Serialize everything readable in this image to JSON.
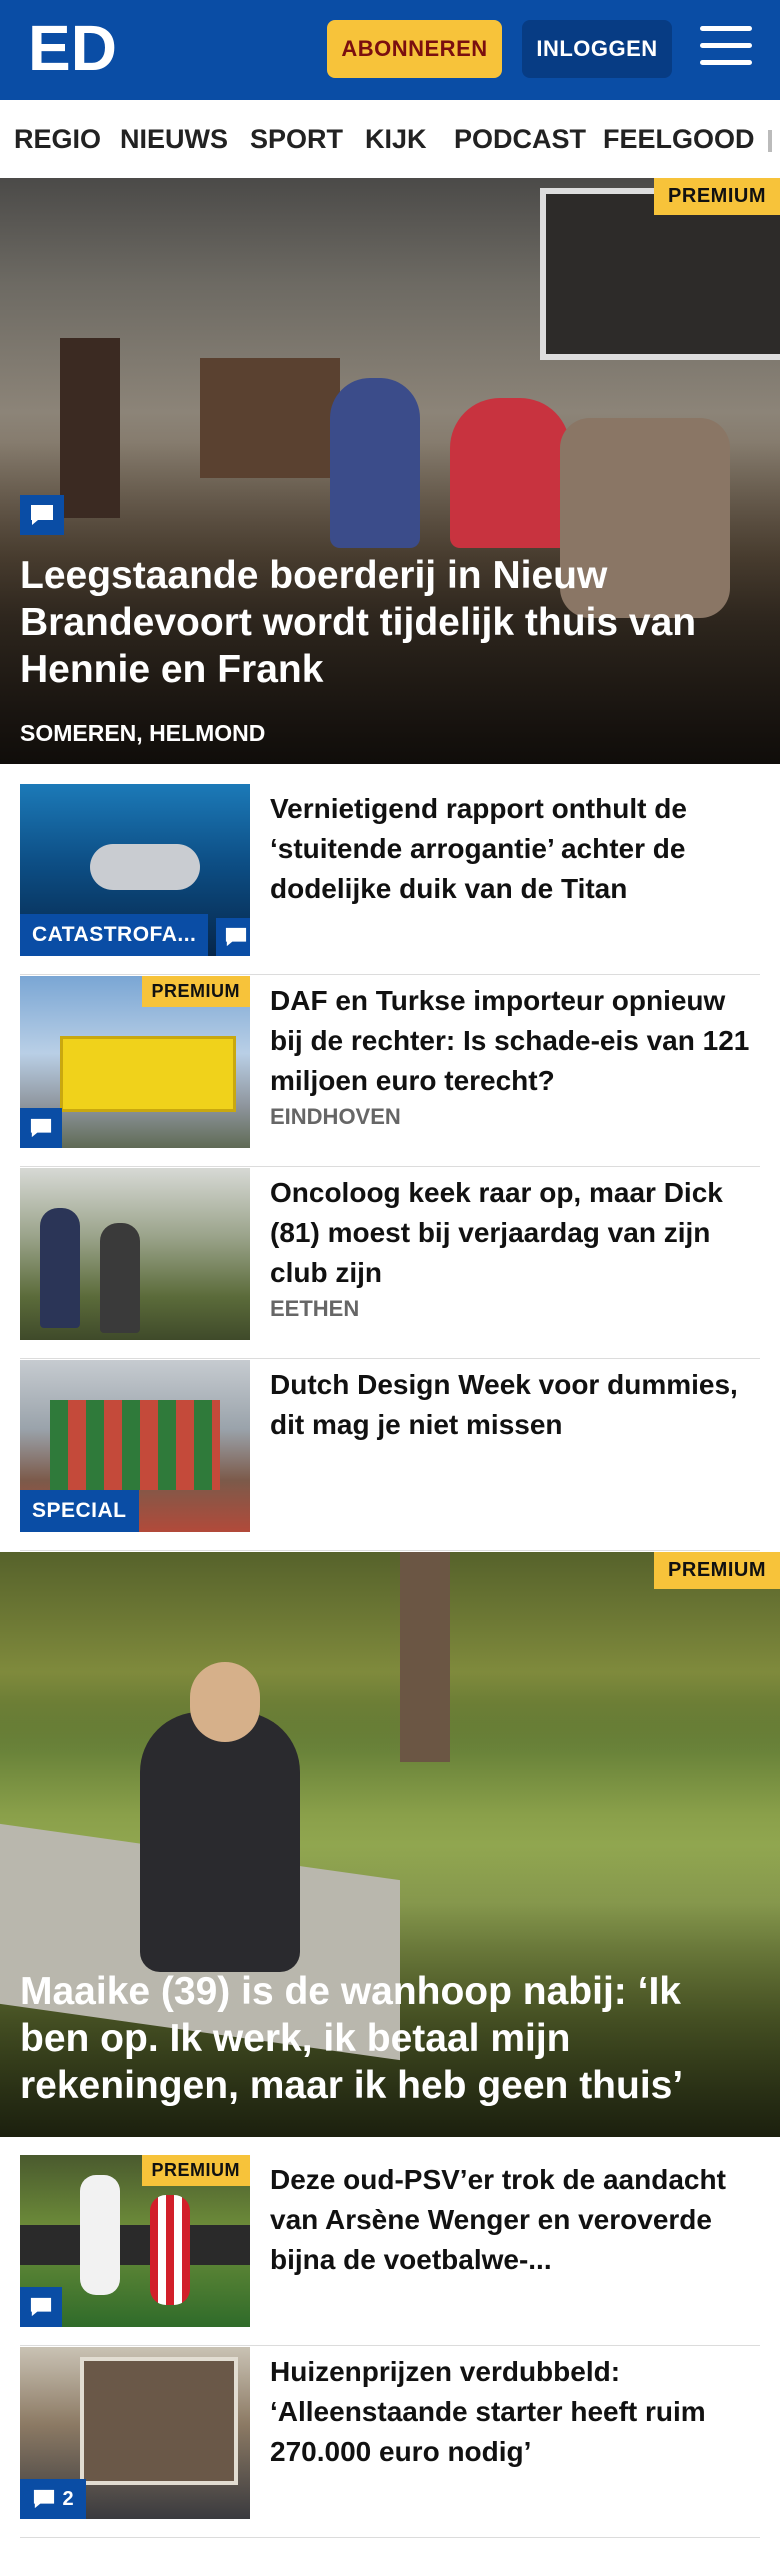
{
  "header": {
    "logo_text": "ED",
    "subscribe_label": "ABONNEREN",
    "login_label": "INLOGGEN"
  },
  "nav": {
    "items": [
      "REGIO",
      "NIEUWS",
      "SPORT",
      "KIJK",
      "PODCAST",
      "FEELGOOD"
    ]
  },
  "hero1": {
    "badge": "PREMIUM",
    "title": "Leegstaande boerderij in Nieuw Brandevoort wordt tijdelijk thuis van Hennie en Frank",
    "location": "SOMEREN, HELMOND",
    "icon": "comment-icon"
  },
  "articles1": [
    {
      "title": "Vernietigend rapport onthult de ‘stuitende arrogantie’ achter de dodelijke duik van de Titan",
      "category": "CATASTROFA...",
      "icon": "comment-icon"
    },
    {
      "badge": "PREMIUM",
      "title": "DAF en Turkse importeur opnieuw bij de rechter: Is schade-eis van 121 miljoen euro terecht?",
      "location": "EINDHOVEN",
      "icon": "comment-icon"
    },
    {
      "title": "Oncoloog keek raar op, maar Dick (81) moest bij verjaardag van zijn club zijn",
      "location": "EETHEN"
    },
    {
      "title": "Dutch Design Week voor dummies, dit mag je niet missen",
      "category": "SPECIAL"
    }
  ],
  "hero2": {
    "badge": "PREMIUM",
    "title": "Maaike (39) is de wanhoop nabij: ‘Ik ben op. Ik werk, ik betaal mijn rekeningen, maar ik heb geen thuis’"
  },
  "articles2": [
    {
      "badge": "PREMIUM",
      "title": "Deze oud-PSV’er trok de aandacht van Arsène Wenger en veroverde bijna de voetbalwe-...",
      "icon": "comment-icon"
    },
    {
      "title": "Huizenprijzen verdubbeld: ‘Alleenstaande starter heeft ruim 270.000 euro nodig’",
      "icon": "comment-icon",
      "comment_count": "2"
    }
  ],
  "colors": {
    "brand_blue": "#0a4da5",
    "premium_yellow": "#f7c33a",
    "subscribe_text": "#7a0f0f"
  }
}
